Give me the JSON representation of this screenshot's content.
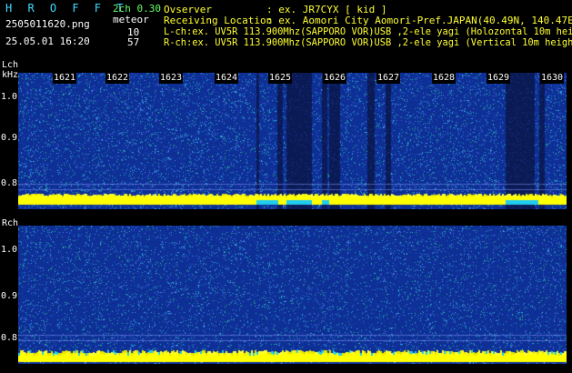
{
  "header": {
    "brand": "H R O F F T",
    "version": "2ch 0.30",
    "filename": "2505011620.png",
    "datetime": "25.05.01 16:20",
    "meteor_label": "meteor",
    "lch_count": "10",
    "rch_count": "57",
    "observer_label": "Ovserver",
    "observer_value": ": ex. JR7CYX [ kid ]",
    "location_label": "Receiving Location",
    "location_value": ": ex. Aomori City Aomori-Pref.JAPAN(40.49N, 140.47E)",
    "lch_desc": "L-ch:ex. UV5R 113.900Mhz(SAPPORO VOR)USB ,2-ele yagi (Holozontal 10m height)",
    "rch_desc": "R-ch:ex. UV5R 113.900Mhz(SAPPORO VOR)USB ,2-ele yagi (Vertical 10m height)"
  },
  "lch": {
    "label": "Lch",
    "unit": "kHz",
    "ticks": [
      "1.0",
      "0.9",
      "0.8"
    ]
  },
  "rch": {
    "label": "Rch",
    "ticks": [
      "1.0",
      "0.9",
      "0.8"
    ]
  },
  "time_ticks": [
    "1621",
    "1622",
    "1623",
    "1624",
    "1625",
    "1626",
    "1627",
    "1628",
    "1629",
    "1630"
  ],
  "colors": {
    "background": "#000000",
    "noise_base": "#1540a8",
    "signal_band": "#ffff00",
    "dark_stripe": "#0a1a55"
  }
}
